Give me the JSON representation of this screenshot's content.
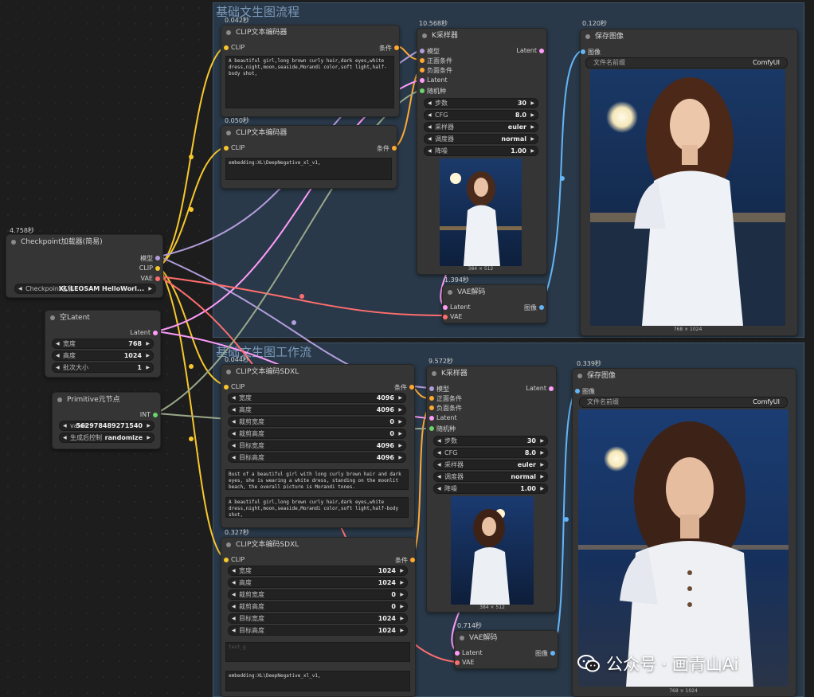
{
  "groups": [
    {
      "title": "基础文生图流程"
    },
    {
      "title": "基础文生图工作流"
    }
  ],
  "timings": {
    "checkpoint": "4.758秒",
    "clip1": "0.042秒",
    "clip2": "0.050秒",
    "ksampler1": "10.568秒",
    "save1": "0.120秒",
    "vae1": "1.394秒",
    "clipxl1": "0.044秒",
    "ksampler2": "9.572秒",
    "save2": "0.339秒",
    "clipxl2": "0.327秒",
    "vae2": "0.714秒"
  },
  "checkpoint": {
    "title": "Checkpoint加载器(简易)",
    "outputs": [
      "模型",
      "CLIP",
      "VAE"
    ],
    "widget_label": "Checkpoint名称",
    "widget_value": "XL\\LEOSAM HelloWorl..."
  },
  "empty_latent": {
    "title": "空Latent",
    "output": "Latent",
    "widgets": [
      {
        "label": "宽度",
        "value": "768"
      },
      {
        "label": "高度",
        "value": "1024"
      },
      {
        "label": "批次大小",
        "value": "1"
      }
    ]
  },
  "primitive": {
    "title": "Primitive元节点",
    "output": "INT",
    "widgets": [
      {
        "label": "value",
        "value": "562978489271540"
      },
      {
        "label": "生成后控制",
        "value": "randomize"
      }
    ]
  },
  "clip_encode1": {
    "title": "CLIP文本编码器",
    "input": "CLIP",
    "output": "条件",
    "text": "A beautiful girl,long brown curly hair,dark eyes,white dress,night,moon,seaside,Morandi color,soft light,half-body shot,"
  },
  "clip_encode2": {
    "title": "CLIP文本编码器",
    "input": "CLIP",
    "output": "条件",
    "text": "embedding:XL\\DeepNegative_xl_v1,"
  },
  "ksampler1": {
    "title": "K采样器",
    "inputs": [
      "模型",
      "正面条件",
      "负面条件",
      "Latent",
      "随机种"
    ],
    "output": "Latent",
    "widgets": [
      {
        "label": "步数",
        "value": "30"
      },
      {
        "label": "CFG",
        "value": "8.0"
      },
      {
        "label": "采样器",
        "value": "euler"
      },
      {
        "label": "调度器",
        "value": "normal"
      },
      {
        "label": "降噪",
        "value": "1.00"
      }
    ],
    "preview_size": "384 × 512"
  },
  "vae_decode1": {
    "title": "VAE解码",
    "inputs": [
      "Latent",
      "VAE"
    ],
    "output": "图像"
  },
  "save1": {
    "title": "保存图像",
    "input": "图像",
    "filename_label": "文件名前缀",
    "filename_value": "ComfyUI",
    "image_size": "768 × 1024"
  },
  "clipxl1": {
    "title": "CLIP文本编码SDXL",
    "input": "CLIP",
    "output": "条件",
    "widgets": [
      {
        "label": "宽度",
        "value": "4096"
      },
      {
        "label": "高度",
        "value": "4096"
      },
      {
        "label": "裁剪宽度",
        "value": "0"
      },
      {
        "label": "裁剪高度",
        "value": "0"
      },
      {
        "label": "目标宽度",
        "value": "4096"
      },
      {
        "label": "目标高度",
        "value": "4096"
      }
    ],
    "text_g": "Bust of a beautiful girl with long curly brown hair and dark eyes, she is wearing a white dress, standing on the moonlit beach, the overall picture is Morandi tones.",
    "text_l": "A beautiful girl,long brown curly hair,dark eyes,white dress,night,moon,seaside,Morandi color,soft light,half-body shot,"
  },
  "clipxl2": {
    "title": "CLIP文本编码SDXL",
    "input": "CLIP",
    "output": "条件",
    "widgets": [
      {
        "label": "宽度",
        "value": "1024"
      },
      {
        "label": "高度",
        "value": "1024"
      },
      {
        "label": "裁剪宽度",
        "value": "0"
      },
      {
        "label": "裁剪高度",
        "value": "0"
      },
      {
        "label": "目标宽度",
        "value": "1024"
      },
      {
        "label": "目标高度",
        "value": "1024"
      }
    ],
    "text_g_placeholder": "text_g",
    "text_l": "embedding:XL\\DeepNegative_xl_v1,"
  },
  "ksampler2": {
    "title": "K采样器",
    "inputs": [
      "模型",
      "正面条件",
      "负面条件",
      "Latent",
      "随机种"
    ],
    "output": "Latent",
    "widgets": [
      {
        "label": "步数",
        "value": "30"
      },
      {
        "label": "CFG",
        "value": "8.0"
      },
      {
        "label": "采样器",
        "value": "euler"
      },
      {
        "label": "调度器",
        "value": "normal"
      },
      {
        "label": "降噪",
        "value": "1.00"
      }
    ],
    "preview_size": "384 × 512"
  },
  "vae_decode2": {
    "title": "VAE解码",
    "inputs": [
      "Latent",
      "VAE"
    ],
    "output": "图像"
  },
  "save2": {
    "title": "保存图像",
    "input": "图像",
    "filename_label": "文件名前缀",
    "filename_value": "ComfyUI",
    "image_size": "768 × 1024"
  },
  "watermark": {
    "text": "公众号 · 画青山Ai"
  },
  "colors": {
    "clip": "#f7c72c",
    "model": "#b39ddb",
    "vae": "#ff6e6e",
    "latent": "#ff9cf9",
    "conditioning": "#ffa931",
    "image": "#64b5f6",
    "int": "#6dd36d",
    "group": "#293949"
  }
}
